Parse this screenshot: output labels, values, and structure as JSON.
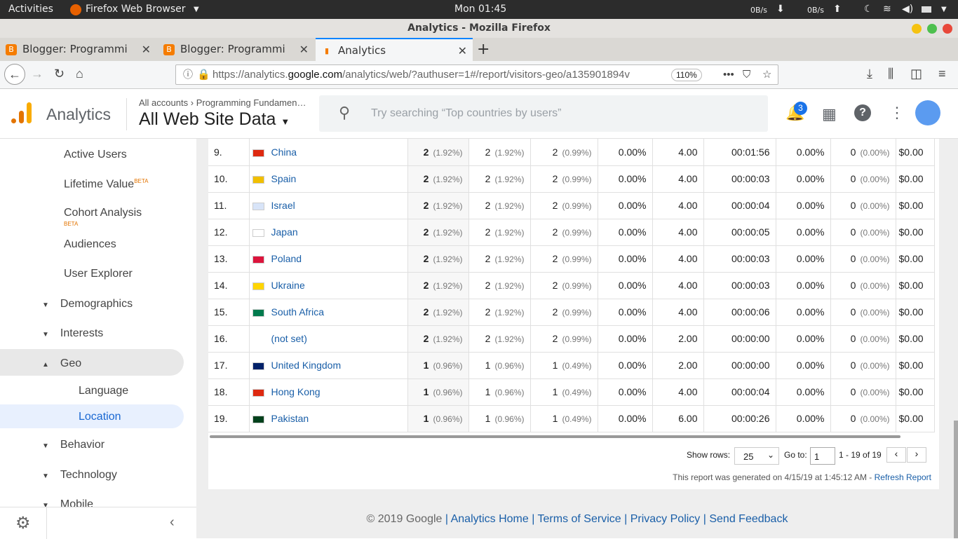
{
  "os": {
    "activities": "Activities",
    "app": "Firefox Web Browser",
    "clock": "Mon 01:45",
    "net_down": "0B/s",
    "net_up": "0B/s"
  },
  "window": {
    "title": "Analytics - Mozilla Firefox"
  },
  "tabs": [
    {
      "label": "Blogger: Programming F"
    },
    {
      "label": "Blogger: Programming F"
    },
    {
      "label": "Analytics"
    }
  ],
  "url": {
    "prefix": "https://analytics.",
    "domain": "google.com",
    "path": "/analytics/web/?authuser=1#/report/visitors-geo/a135901894v",
    "zoom": "110%"
  },
  "ga": {
    "brand": "Analytics",
    "breadcrumb_root": "All accounts",
    "breadcrumb_child": "Programming Fundamen…",
    "view": "All Web Site Data",
    "search_placeholder": "Try searching “Top countries by users”",
    "notif_count": "3"
  },
  "sidebar": {
    "items": [
      {
        "label": "Active Users"
      },
      {
        "label": "Lifetime Value",
        "badge": "BETA"
      },
      {
        "label": "Cohort Analysis",
        "badge": "BETA"
      },
      {
        "label": "Audiences"
      },
      {
        "label": "User Explorer"
      },
      {
        "label": "Demographics"
      },
      {
        "label": "Interests"
      },
      {
        "label": "Geo"
      },
      {
        "label": "Language"
      },
      {
        "label": "Location"
      },
      {
        "label": "Behavior"
      },
      {
        "label": "Technology"
      },
      {
        "label": "Mobile"
      }
    ]
  },
  "rows": [
    {
      "idx": "9.",
      "country": "China",
      "users": "2",
      "users_pct": "(1.92%)",
      "new": "2",
      "new_pct": "(1.92%)",
      "sess": "2",
      "sess_pct": "(0.99%)",
      "bounce": "0.00%",
      "pps": "4.00",
      "dur": "00:01:56",
      "conv": "0.00%",
      "goal": "0",
      "goal_pct": "(0.00%)",
      "val": "$0.00",
      "flag": "#de2910"
    },
    {
      "idx": "10.",
      "country": "Spain",
      "users": "2",
      "users_pct": "(1.92%)",
      "new": "2",
      "new_pct": "(1.92%)",
      "sess": "2",
      "sess_pct": "(0.99%)",
      "bounce": "0.00%",
      "pps": "4.00",
      "dur": "00:00:03",
      "conv": "0.00%",
      "goal": "0",
      "goal_pct": "(0.00%)",
      "val": "$0.00",
      "flag": "#f1bf00"
    },
    {
      "idx": "11.",
      "country": "Israel",
      "users": "2",
      "users_pct": "(1.92%)",
      "new": "2",
      "new_pct": "(1.92%)",
      "sess": "2",
      "sess_pct": "(0.99%)",
      "bounce": "0.00%",
      "pps": "4.00",
      "dur": "00:00:04",
      "conv": "0.00%",
      "goal": "0",
      "goal_pct": "(0.00%)",
      "val": "$0.00",
      "flag": "#d8e4f8"
    },
    {
      "idx": "12.",
      "country": "Japan",
      "users": "2",
      "users_pct": "(1.92%)",
      "new": "2",
      "new_pct": "(1.92%)",
      "sess": "2",
      "sess_pct": "(0.99%)",
      "bounce": "0.00%",
      "pps": "4.00",
      "dur": "00:00:05",
      "conv": "0.00%",
      "goal": "0",
      "goal_pct": "(0.00%)",
      "val": "$0.00",
      "flag": "#ffffff"
    },
    {
      "idx": "13.",
      "country": "Poland",
      "users": "2",
      "users_pct": "(1.92%)",
      "new": "2",
      "new_pct": "(1.92%)",
      "sess": "2",
      "sess_pct": "(0.99%)",
      "bounce": "0.00%",
      "pps": "4.00",
      "dur": "00:00:03",
      "conv": "0.00%",
      "goal": "0",
      "goal_pct": "(0.00%)",
      "val": "$0.00",
      "flag": "#dc143c"
    },
    {
      "idx": "14.",
      "country": "Ukraine",
      "users": "2",
      "users_pct": "(1.92%)",
      "new": "2",
      "new_pct": "(1.92%)",
      "sess": "2",
      "sess_pct": "(0.99%)",
      "bounce": "0.00%",
      "pps": "4.00",
      "dur": "00:00:03",
      "conv": "0.00%",
      "goal": "0",
      "goal_pct": "(0.00%)",
      "val": "$0.00",
      "flag": "#ffd500"
    },
    {
      "idx": "15.",
      "country": "South Africa",
      "users": "2",
      "users_pct": "(1.92%)",
      "new": "2",
      "new_pct": "(1.92%)",
      "sess": "2",
      "sess_pct": "(0.99%)",
      "bounce": "0.00%",
      "pps": "4.00",
      "dur": "00:00:06",
      "conv": "0.00%",
      "goal": "0",
      "goal_pct": "(0.00%)",
      "val": "$0.00",
      "flag": "#007a4d"
    },
    {
      "idx": "16.",
      "country": "(not set)",
      "users": "2",
      "users_pct": "(1.92%)",
      "new": "2",
      "new_pct": "(1.92%)",
      "sess": "2",
      "sess_pct": "(0.99%)",
      "bounce": "0.00%",
      "pps": "2.00",
      "dur": "00:00:00",
      "conv": "0.00%",
      "goal": "0",
      "goal_pct": "(0.00%)",
      "val": "$0.00",
      "flag": ""
    },
    {
      "idx": "17.",
      "country": "United Kingdom",
      "users": "1",
      "users_pct": "(0.96%)",
      "new": "1",
      "new_pct": "(0.96%)",
      "sess": "1",
      "sess_pct": "(0.49%)",
      "bounce": "0.00%",
      "pps": "2.00",
      "dur": "00:00:00",
      "conv": "0.00%",
      "goal": "0",
      "goal_pct": "(0.00%)",
      "val": "$0.00",
      "flag": "#012169"
    },
    {
      "idx": "18.",
      "country": "Hong Kong",
      "users": "1",
      "users_pct": "(0.96%)",
      "new": "1",
      "new_pct": "(0.96%)",
      "sess": "1",
      "sess_pct": "(0.49%)",
      "bounce": "0.00%",
      "pps": "4.00",
      "dur": "00:00:04",
      "conv": "0.00%",
      "goal": "0",
      "goal_pct": "(0.00%)",
      "val": "$0.00",
      "flag": "#de2910"
    },
    {
      "idx": "19.",
      "country": "Pakistan",
      "users": "1",
      "users_pct": "(0.96%)",
      "new": "1",
      "new_pct": "(0.96%)",
      "sess": "1",
      "sess_pct": "(0.49%)",
      "bounce": "0.00%",
      "pps": "6.00",
      "dur": "00:00:26",
      "conv": "0.00%",
      "goal": "0",
      "goal_pct": "(0.00%)",
      "val": "$0.00",
      "flag": "#01411c"
    }
  ],
  "pager": {
    "show_rows_label": "Show rows:",
    "rows_value": "25",
    "goto_label": "Go to:",
    "goto_value": "1",
    "range": "1 - 19 of 19"
  },
  "report": {
    "generated": "This report was generated on 4/15/19 at 1:45:12 AM - ",
    "refresh": "Refresh Report"
  },
  "footer": {
    "copyright": "© 2019 Google",
    "links": [
      "Analytics Home",
      "Terms of Service",
      "Privacy Policy",
      "Send Feedback"
    ]
  }
}
